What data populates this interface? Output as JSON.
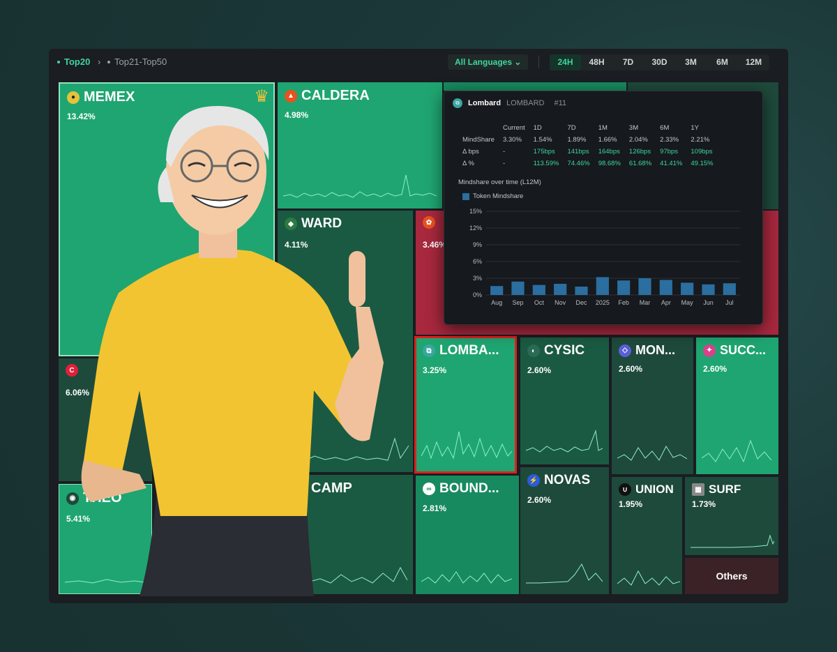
{
  "breadcrumbs": [
    {
      "label": "Top20",
      "active": true
    },
    {
      "label": "Top21-Top50",
      "active": false
    }
  ],
  "language": "All Languages",
  "ranges": [
    "24H",
    "48H",
    "7D",
    "30D",
    "3M",
    "6M",
    "12M"
  ],
  "active_range": "24H",
  "tiles": [
    {
      "id": "memex",
      "name": "MEMEX",
      "pct": "13.42%",
      "color": "#1fa571",
      "icon_color": "#e5c23b",
      "icon": "coin-icon"
    },
    {
      "id": "caldera",
      "name": "CALDERA",
      "pct": "4.98%",
      "color": "#1fa571",
      "icon_color": "#e8521e",
      "icon": "volcano-icon"
    },
    {
      "id": "ward",
      "name": "WARD",
      "pct": "4.11%",
      "color": "#1b5a42",
      "icon_color": "#2c7a3f",
      "icon": "shield-icon"
    },
    {
      "id": "lombard",
      "name": "LOMBA...",
      "pct": "3.25%",
      "color": "#1fa571",
      "icon_color": "#3aa6a0",
      "icon": "lombard-icon"
    },
    {
      "id": "cysic",
      "name": "CYSIC",
      "pct": "2.60%",
      "color": "#1b5a42",
      "icon_color": "#2a6b55",
      "icon": "cysic-icon"
    },
    {
      "id": "mon",
      "name": "MON...",
      "pct": "2.60%",
      "color": "#1e4a3b",
      "icon_color": "#5a5fd8",
      "icon": "monad-icon"
    },
    {
      "id": "succ",
      "name": "SUCC...",
      "pct": "2.60%",
      "color": "#1fa571",
      "icon_color": "#d8418c",
      "icon": "succinct-icon"
    },
    {
      "id": "bound",
      "name": "BOUND...",
      "pct": "2.81%",
      "color": "#188a5f",
      "icon_color": "#ffffff",
      "icon": "boundless-icon"
    },
    {
      "id": "novas",
      "name": "NOVAS",
      "pct": "2.60%",
      "color": "#1e4a3b",
      "icon_color": "#2a5cd8",
      "icon": "novas-icon"
    },
    {
      "id": "union",
      "name": "UNION",
      "pct": "1.95%",
      "color": "#1e4a3b",
      "icon_color": "#111111",
      "icon": "union-icon"
    },
    {
      "id": "surf",
      "name": "SURF",
      "pct": "1.73%",
      "color": "#1e4a3b",
      "icon_color": "#888888",
      "icon": "surf-icon"
    },
    {
      "id": "theo",
      "name": "THEO",
      "pct": "5.41%",
      "color": "#1fa571",
      "icon_color": "#1e4a3b",
      "icon": "theo-icon"
    },
    {
      "id": "c6",
      "name": "",
      "pct": "6.06%",
      "color": "#1e4a3b",
      "icon_color": "#e0203a",
      "icon": "c-icon"
    },
    {
      "id": "red",
      "name": "",
      "pct": "3.46%",
      "color": "#a8283e",
      "icon_color": "#e8521e",
      "icon": "red-icon"
    },
    {
      "id": "camp",
      "name": "CAMP",
      "pct": "",
      "color": "#1b5a42",
      "icon_color": "",
      "icon": ""
    }
  ],
  "others_label": "Others",
  "popup": {
    "name": "Lombard",
    "symbol": "LOMBARD",
    "rank": "#11",
    "columns": [
      "",
      "Current",
      "1D",
      "7D",
      "1M",
      "3M",
      "6M",
      "1Y"
    ],
    "rows": [
      {
        "label": "MindShare",
        "cells": [
          "3.30%",
          "1.54%",
          "1.89%",
          "1.66%",
          "2.04%",
          "2.33%",
          "2.21%"
        ],
        "up": false
      },
      {
        "label": "Δ bps",
        "cells": [
          "-",
          "175bps",
          "141bps",
          "164bps",
          "126bps",
          "97bps",
          "109bps"
        ],
        "up": true
      },
      {
        "label": "Δ %",
        "cells": [
          "-",
          "113.59%",
          "74.46%",
          "98.68%",
          "61.68%",
          "41.41%",
          "49.15%"
        ],
        "up": true
      }
    ],
    "chart_title": "Mindshare over time (L12M)",
    "legend": "Token Mindshare"
  },
  "chart_data": {
    "type": "bar",
    "categories": [
      "Aug",
      "Sep",
      "Oct",
      "Nov",
      "Dec",
      "2025",
      "Feb",
      "Mar",
      "Apr",
      "May",
      "Jun",
      "Jul"
    ],
    "series": [
      {
        "name": "Token Mindshare",
        "values": [
          1.6,
          2.4,
          1.8,
          2.0,
          1.5,
          3.2,
          2.6,
          3.0,
          2.7,
          2.2,
          1.9,
          2.1
        ]
      }
    ],
    "ylim": [
      0,
      15
    ],
    "yticks": [
      "0%",
      "3%",
      "6%",
      "9%",
      "12%",
      "15%"
    ],
    "grid": true,
    "legend_position": "top-left"
  },
  "colors": {
    "accent": "#3fd6a0",
    "highlight": "#e0201e",
    "bar": "#2b6ea0"
  }
}
